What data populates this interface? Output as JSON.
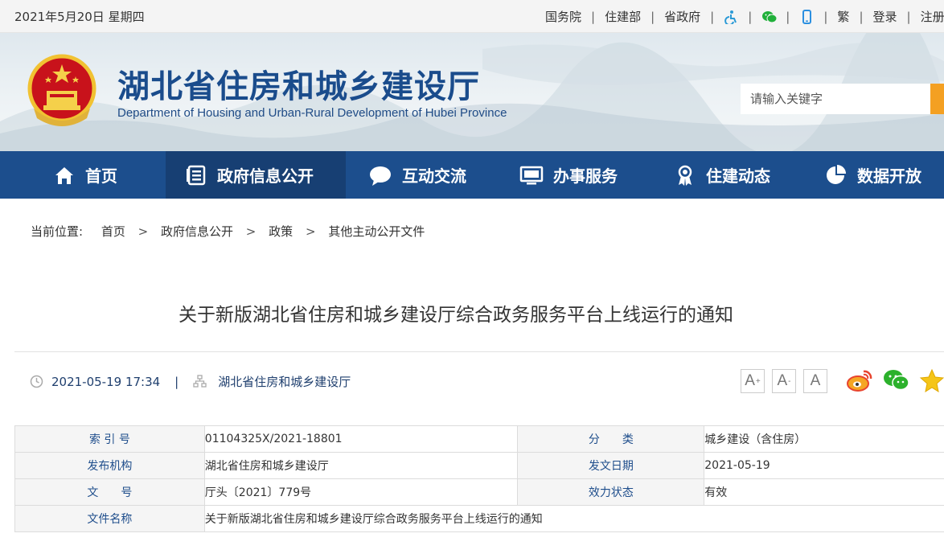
{
  "topbar": {
    "date": "2021年5月20日 星期四",
    "links": [
      "国务院",
      "住建部",
      "省政府"
    ],
    "icons": [
      "accessibility-icon",
      "wechat-icon",
      "mobile-icon"
    ],
    "lang": "繁",
    "login": "登录",
    "register": "注册"
  },
  "header": {
    "title_cn": "湖北省住房和城乡建设厅",
    "title_en": "Department of Housing and Urban-Rural Development of Hubei Province",
    "search_placeholder": "请输入关键字"
  },
  "nav": [
    {
      "label": "首页",
      "icon": "home-icon"
    },
    {
      "label": "政府信息公开",
      "icon": "document-list-icon",
      "active": true
    },
    {
      "label": "互动交流",
      "icon": "chat-bubble-icon"
    },
    {
      "label": "办事服务",
      "icon": "monitor-icon"
    },
    {
      "label": "住建动态",
      "icon": "award-icon"
    },
    {
      "label": "数据开放",
      "icon": "pie-chart-icon"
    }
  ],
  "breadcrumb": {
    "label": "当前位置:",
    "items": [
      "首页",
      "政府信息公开",
      "政策",
      "其他主动公开文件"
    ],
    "separator": ">"
  },
  "article": {
    "title": "关于新版湖北省住房和城乡建设厅综合政务服务平台上线运行的通知",
    "datetime": "2021-05-19 17:34",
    "separator": "|",
    "source": "湖北省住房和城乡建设厅",
    "font_buttons": [
      "A",
      "A",
      "A"
    ],
    "share_icons": [
      "weibo-icon",
      "wechat-icon",
      "star-icon"
    ]
  },
  "info_table": {
    "rows": [
      {
        "k1": "索 引 号",
        "v1": "01104325X/2021-18801",
        "k2": "分　　类",
        "v2": "城乡建设（含住房）"
      },
      {
        "k1": "发布机构",
        "v1": "湖北省住房和城乡建设厅",
        "k2": "发文日期",
        "v2": "2021-05-19"
      },
      {
        "k1": "文　　号",
        "v1": "厅头〔2021〕779号",
        "k2": "效力状态",
        "v2": "有效"
      }
    ],
    "last_row": {
      "k": "文件名称",
      "v": "关于新版湖北省住房和城乡建设厅综合政务服务平台上线运行的通知"
    }
  },
  "colors": {
    "nav_bg": "#1c4e8d",
    "nav_active": "#173f73",
    "title_blue": "#1a4c8c",
    "search_btn": "#f4a022"
  }
}
